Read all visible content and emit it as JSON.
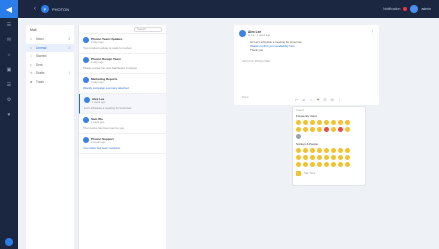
{
  "topbar": {
    "logo": "◀",
    "back": "‹",
    "org_initial": "P",
    "org_name": "PHOTON",
    "right_text": "Notification",
    "user_name": "admin"
  },
  "rail": {
    "icons": [
      "☰",
      "✉",
      "☼",
      "▣",
      "☰",
      "⚙",
      "♥"
    ]
  },
  "sidenav": {
    "title": "Mail",
    "items": [
      {
        "label": "Inbox",
        "count": "4",
        "icon": "□"
      },
      {
        "label": "Unread",
        "count": "2",
        "icon": "□"
      },
      {
        "label": "Starred",
        "count": "",
        "icon": "☆"
      },
      {
        "label": "Sent",
        "count": "",
        "icon": "▷"
      },
      {
        "label": "Drafts",
        "count": "1",
        "icon": "✎"
      },
      {
        "label": "Trash",
        "count": "",
        "icon": "✖"
      }
    ],
    "active_index": 1
  },
  "list": {
    "search_placeholder": "Search",
    "messages": [
      {
        "sender": "Photon Team Updates",
        "sub": "2 days ago",
        "preview": "Your product update is ready for review",
        "link": false
      },
      {
        "sender": "Photon Design Team",
        "sub": "3 days ago",
        "preview": "Please review the new dashboard mockups",
        "link": false
      },
      {
        "sender": "Marketing Reports",
        "sub": "4 days ago",
        "preview": "Weekly campaign summary attached",
        "link": true
      },
      {
        "sender": "Alex Lee",
        "sub": "1 week ago",
        "preview": "Let's schedule a meeting for tomorrow",
        "link": false
      },
      {
        "sender": "Sam Wu",
        "sub": "1 week ago",
        "preview": "The invoice has been sent to you",
        "link": false
      },
      {
        "sender": "Photon Support",
        "sub": "2 weeks ago",
        "preview": "Your ticket has been resolved",
        "link": true
      }
    ],
    "active_index": 3
  },
  "main": {
    "sender": "Alex Lee",
    "time": "to me · 1 week ago",
    "body_line1": "Hi! Let's schedule a meeting for tomorrow.",
    "body_link": "Please confirm your availability here",
    "body_line3": "Thank you",
    "quoted": "Sent from Photon Mail",
    "date": "Reply"
  },
  "toolbar": {
    "icons": [
      "↩",
      "☺",
      "☆",
      "⚑",
      "⎘",
      "✉",
      "⋮"
    ]
  },
  "picker": {
    "placeholder": "Search",
    "category1": "Frequently Used",
    "category2": "Smileys & People",
    "footer_text": "Skin Tone"
  },
  "colors": {
    "accent": "#2b7de9",
    "sidebar_bg": "#1b2740",
    "emoji": "#f2c230"
  }
}
